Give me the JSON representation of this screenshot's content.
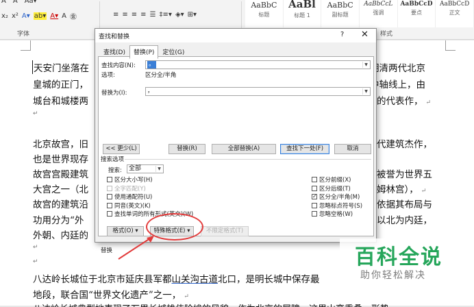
{
  "ribbon": {
    "font_group_label": "字体",
    "styles_group_label": "样式",
    "styles": [
      {
        "sample": "AaBbC",
        "name": "标题"
      },
      {
        "sample": "AaBl",
        "name": "标题 1"
      },
      {
        "sample": "AaBbC",
        "name": "副标题"
      },
      {
        "sample": "AaBbCcL",
        "name": "强调"
      },
      {
        "sample": "AaBbCcD",
        "name": "要点"
      },
      {
        "sample": "AaBbCcD",
        "name": "正文"
      }
    ]
  },
  "document": {
    "lines": [
      "天安门坐落在",
      "皇城的正门，",
      "城台和城楼两",
      "北京故宫，旧",
      "也是世界现存",
      "故宫宫殿建筑",
      "大宫之一（北",
      "故宫的建筑沿",
      "功用分为“外",
      "外朝、内廷的",
      "八达岭长城位于北京市延庆县军都山关沟古道北口，是明长城中保存最",
      "地段，联合国“世界文化遗产”之一，",
      "八达岭长城典型地表现了万里长城雄伟险峻的风貌。作为北京的屏障，这里山峦重叠，形势"
    ],
    "right_lines": [
      "明清两代北京",
      "中轴线上，由",
      "的代表作，",
      "代建筑杰作，",
      "被誉为世界五",
      "姆林宫），",
      "依据其布局与",
      "以北为内廷，"
    ]
  },
  "dialog": {
    "title": "查找和替换",
    "help": "?",
    "close": "✕",
    "tabs": [
      "查找(D)",
      "替换(P)",
      "定位(G)"
    ],
    "find_label": "查找内容(N):",
    "find_value": "。",
    "options_label": "选项:",
    "options_value": "区分全/半角",
    "replace_label": "替换为(I):",
    "replace_value": "，",
    "buttons": {
      "less": "<< 更少(L)",
      "replace": "替换(R)",
      "replace_all": "全部替换(A)",
      "find_next": "查找下一处(F)",
      "cancel": "取消"
    },
    "search_options_label": "搜索选项",
    "search_label": "搜索:",
    "search_value": "全部",
    "left_checks": [
      {
        "label": "区分大小写(H)",
        "checked": false,
        "disabled": false
      },
      {
        "label": "全字匹配(Y)",
        "checked": false,
        "disabled": true
      },
      {
        "label": "使用通配符(U)",
        "checked": false,
        "disabled": false
      },
      {
        "label": "同音(英文)(K)",
        "checked": false,
        "disabled": false
      },
      {
        "label": "查找单词的所有形式(英文)(W)",
        "checked": false,
        "disabled": false
      }
    ],
    "right_checks": [
      {
        "label": "区分前缀(X)",
        "checked": false,
        "disabled": false
      },
      {
        "label": "区分后缀(T)",
        "checked": false,
        "disabled": false
      },
      {
        "label": "区分全/半角(M)",
        "checked": true,
        "disabled": false
      },
      {
        "label": "忽略标点符号(S)",
        "checked": false,
        "disabled": false
      },
      {
        "label": "忽略空格(W)",
        "checked": false,
        "disabled": false
      }
    ],
    "replace_section_label": "替换",
    "bottom_buttons": {
      "format": "格式(O) ▾",
      "special": "特殊格式(E) ▾",
      "no_format": "不限定格式(T)"
    }
  },
  "watermark": {
    "title": "百科全说",
    "subtitle": "助你轻松解决"
  },
  "colors": {
    "accent": "#3b7fd6",
    "annotation_red": "#e23a3a",
    "watermark_green": "#26a65b"
  }
}
